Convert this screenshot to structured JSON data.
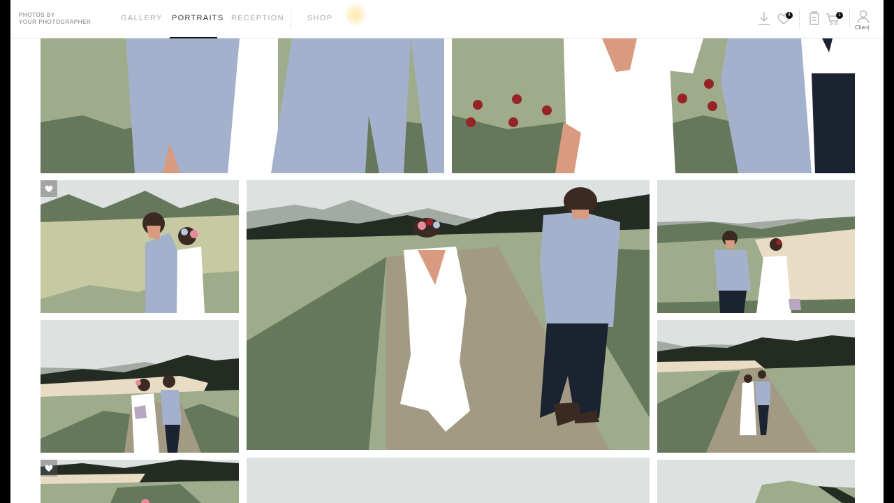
{
  "header": {
    "brand_line1": "PHOTOS BY",
    "brand_line2": "YOUR PHOTOGRAPHER",
    "nav": [
      {
        "label": "GALLERY",
        "active": false
      },
      {
        "label": "PORTRAITS",
        "active": true
      },
      {
        "label": "RECEPTION",
        "active": false
      },
      {
        "label": "SHOP",
        "active": false
      }
    ],
    "icons": {
      "download": "download-icon",
      "favorites": "heart-icon",
      "favorites_count": "4",
      "orders": "clipboard-icon",
      "cart": "cart-icon",
      "cart_count": "1",
      "client": "user-icon"
    },
    "client_label": "Client"
  },
  "gallery": {
    "photos": [
      {
        "id": "legs-blue-suit",
        "favorited": false
      },
      {
        "id": "couple-poppies",
        "favorited": false
      },
      {
        "id": "couple-embrace",
        "favorited": true
      },
      {
        "id": "couple-walking-path",
        "favorited": false
      },
      {
        "id": "couple-holding-hands",
        "favorited": false
      },
      {
        "id": "couple-hillside",
        "favorited": false
      },
      {
        "id": "couple-path-distant",
        "favorited": false
      },
      {
        "id": "landscape-partial",
        "favorited": true
      },
      {
        "id": "sky-partial",
        "favorited": false
      },
      {
        "id": "hills-partial",
        "favorited": false
      }
    ]
  },
  "colors": {
    "sky": "#dde2e0",
    "dark_hill": "#242b23",
    "mid_green": "#66785c",
    "light_green": "#9fac8c",
    "pale_green": "#c6c9a1",
    "sand": "#e9dcc4",
    "path": "#a29a83",
    "suit_blue": "#a4b1cc",
    "trousers": "#1b2330",
    "skin": "#d89b80",
    "hair": "#3a2a22",
    "dress": "#ffffff",
    "poppy": "#962426",
    "accent_active": "#111111"
  }
}
